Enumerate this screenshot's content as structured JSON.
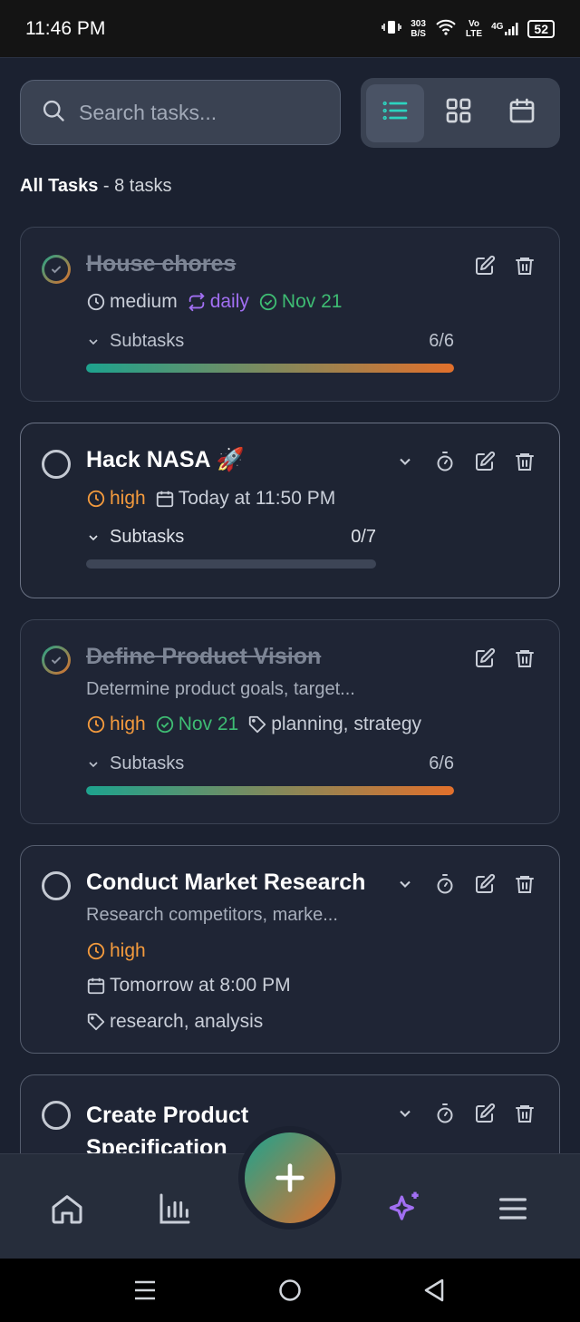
{
  "status_bar": {
    "time": "11:46 PM",
    "net_speed_top": "303",
    "net_speed_bottom": "B/S",
    "volte_top": "Vo",
    "volte_bottom": "LTE",
    "network": "4G",
    "battery": "52"
  },
  "search": {
    "placeholder": "Search tasks..."
  },
  "view_toggle": {
    "active": "list",
    "options": [
      "list-icon",
      "grid-icon",
      "calendar-icon"
    ]
  },
  "header": {
    "title": "All Tasks",
    "count_text": " - 8 tasks"
  },
  "tasks": [
    {
      "title": "House chores",
      "completed": true,
      "priority": "medium",
      "recurrence": "daily",
      "completed_date": "Nov 21",
      "subtasks_label": "Subtasks",
      "subtasks_count": "6/6",
      "progress": 1.0
    },
    {
      "title": "Hack NASA 🚀",
      "completed": false,
      "priority": "high",
      "due": "Today at 11:50 PM",
      "subtasks_label": "Subtasks",
      "subtasks_count": "0/7",
      "progress": 0.0
    },
    {
      "title": "Define Product Vision",
      "completed": true,
      "description": "Determine product goals, target...",
      "priority": "high",
      "completed_date": "Nov 21",
      "tags": "planning, strategy",
      "subtasks_label": "Subtasks",
      "subtasks_count": "6/6",
      "progress": 1.0
    },
    {
      "title": "Conduct Market Research",
      "completed": false,
      "description": "Research competitors, marke...",
      "priority": "high",
      "due": "Tomorrow at 8:00 PM",
      "tags": "research, analysis"
    },
    {
      "title_line1": "Create Product",
      "title_line2": "Specification",
      "completed": false
    }
  ],
  "bottom_nav": [
    "home-icon",
    "stats-icon",
    "add-task-button",
    "ai-sparkle-icon",
    "menu-icon"
  ],
  "colors": {
    "background": "#1b2130",
    "accent_teal": "#1da38e",
    "accent_orange": "#e2702b",
    "high_priority": "#f39a3d",
    "done_green": "#3ebc73",
    "recur_purple": "#a16ff2"
  }
}
